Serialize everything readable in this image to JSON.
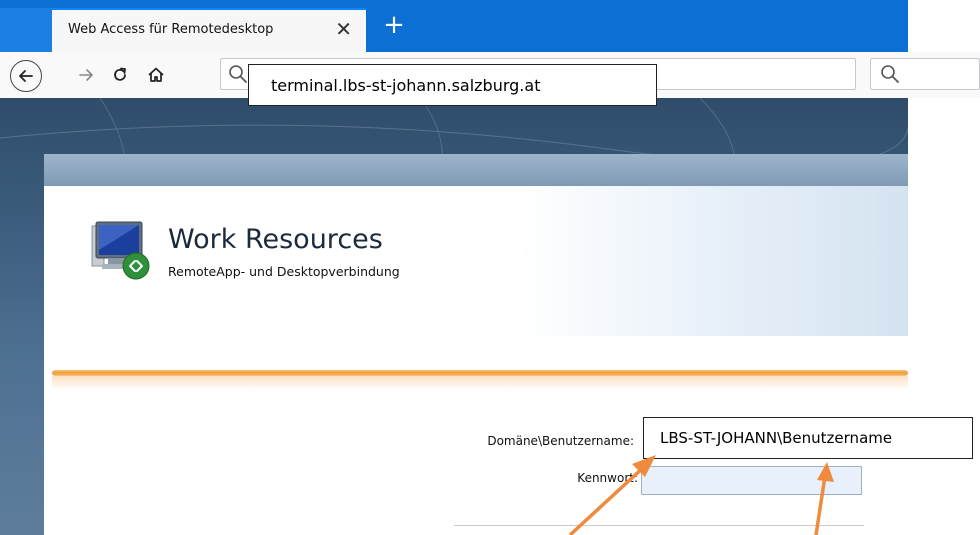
{
  "browser": {
    "tab_title": "Web Access für Remotedesktop",
    "tab_close": "✕",
    "new_tab": "+",
    "url": "terminal.lbs-st-johann.salzburg.at"
  },
  "page": {
    "title": "Work Resources",
    "subtitle": "RemoteApp- und Desktopverbindung",
    "login": {
      "username_label": "Domäne\\Benutzername:",
      "username_value": "LBS-ST-JOHANN\\Benutzername",
      "password_label": "Kennwort:"
    }
  },
  "colors": {
    "tab_strip": "#0b6fd3",
    "accent_orange": "#f29a2e",
    "arrow": "#f08a3c",
    "input_fill": "#e8f0fb"
  },
  "icons": [
    "back-icon",
    "forward-icon",
    "reload-icon",
    "home-icon",
    "search-icon",
    "remote-desktop-icon"
  ]
}
